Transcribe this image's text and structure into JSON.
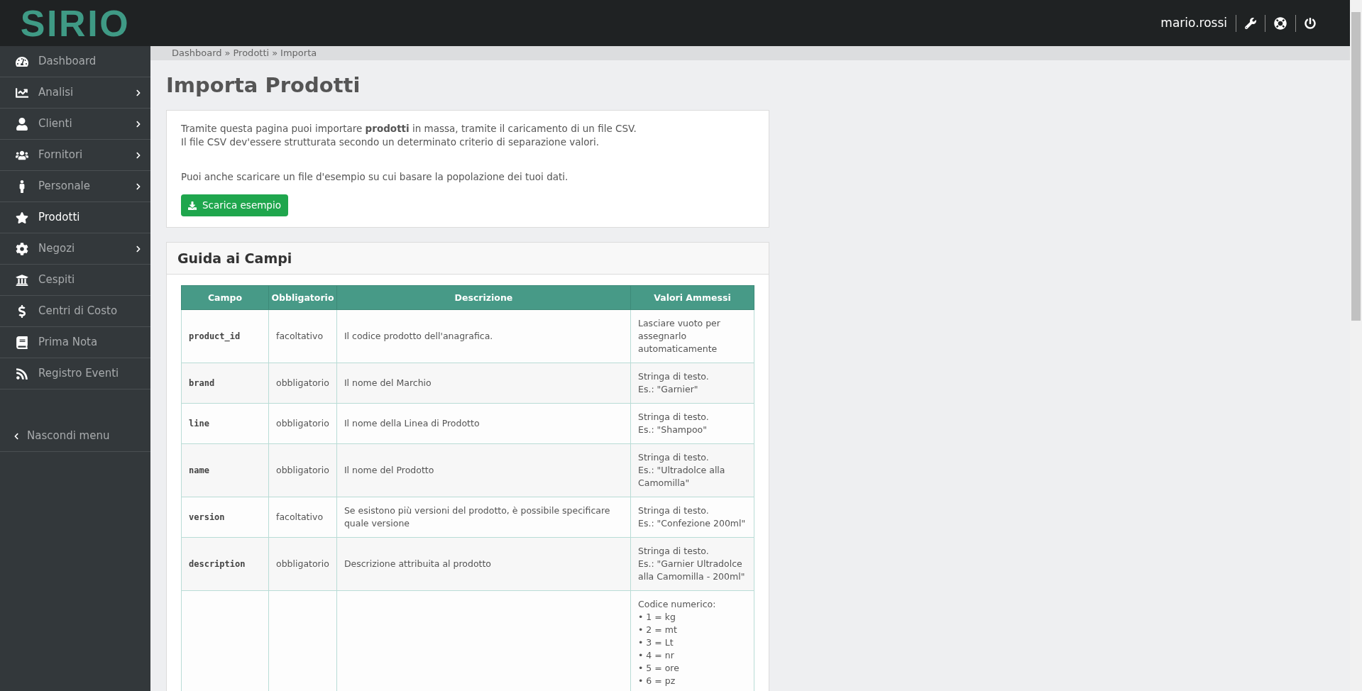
{
  "header": {
    "logo": "SIRIO",
    "username": "mario.rossi"
  },
  "sidebar": {
    "items": [
      {
        "label": "Dashboard",
        "selected": false,
        "expandable": false
      },
      {
        "label": "Analisi",
        "selected": false,
        "expandable": true
      },
      {
        "label": "Clienti",
        "selected": false,
        "expandable": true
      },
      {
        "label": "Fornitori",
        "selected": false,
        "expandable": true
      },
      {
        "label": "Personale",
        "selected": false,
        "expandable": true
      },
      {
        "label": "Prodotti",
        "selected": true,
        "expandable": false
      },
      {
        "label": "Negozi",
        "selected": false,
        "expandable": true
      },
      {
        "label": "Cespiti",
        "selected": false,
        "expandable": false
      },
      {
        "label": "Centri di Costo",
        "selected": false,
        "expandable": false
      },
      {
        "label": "Prima Nota",
        "selected": false,
        "expandable": false
      },
      {
        "label": "Registro Eventi",
        "selected": false,
        "expandable": false
      }
    ],
    "hide_menu": "Nascondi menu"
  },
  "breadcrumb": [
    "Dashboard",
    "Prodotti",
    "Importa"
  ],
  "breadcrumb_separator": "»",
  "title": "Importa Prodotti",
  "intro": {
    "lines": [
      "Tramite questa pagina puoi importare **prodotti** in massa, tramite il caricamento di un file CSV.",
      "Il file CSV dev'essere strutturata secondo un determinato criterio di separazione valori."
    ],
    "note": "Puoi anche scaricare un file d'esempio su cui basare la popolazione dei tuoi dati.",
    "button": "Scarica esempio"
  },
  "guide": {
    "title": "Guida ai Campi",
    "table": {
      "columns": [
        "Campo",
        "Obbligatorio",
        "Descrizione",
        "Valori Ammessi"
      ],
      "rows": [
        {
          "campo": "product_id",
          "obbligatorio": "facoltativo",
          "descrizione": "Il codice prodotto dell'anagrafica.",
          "valori": [
            "Lasciare vuoto per assegnarlo automaticamente"
          ]
        },
        {
          "campo": "brand",
          "obbligatorio": "obbligatorio",
          "descrizione": "Il nome del Marchio",
          "valori": [
            "Stringa di testo.",
            "Es.: \"Garnier\""
          ]
        },
        {
          "campo": "line",
          "obbligatorio": "obbligatorio",
          "descrizione": "Il nome della Linea di Prodotto",
          "valori": [
            "Stringa di testo.",
            "Es.: \"Shampoo\""
          ]
        },
        {
          "campo": "name",
          "obbligatorio": "obbligatorio",
          "descrizione": "Il nome del Prodotto",
          "valori": [
            "Stringa di testo.",
            "Es.: \"Ultradolce alla Camomilla\""
          ]
        },
        {
          "campo": "version",
          "obbligatorio": "facoltativo",
          "descrizione": "Se esistono più versioni del prodotto, è possibile specificare quale versione",
          "valori": [
            "Stringa di testo.",
            "Es.: \"Confezione 200ml\""
          ]
        },
        {
          "campo": "description",
          "obbligatorio": "obbligatorio",
          "descrizione": "Descrizione attribuita al prodotto",
          "valori": [
            "Stringa di testo.",
            "Es.: \"Garnier Ultradolce alla Camomilla - 200ml\""
          ]
        },
        {
          "valori": [
            "Codice numerico:",
            "• 1 = kg",
            "• 2 = mt",
            "• 3 = Lt",
            "• 4 = nr",
            "• 5 = ore",
            "• 6 = pz"
          ]
        }
      ]
    }
  }
}
